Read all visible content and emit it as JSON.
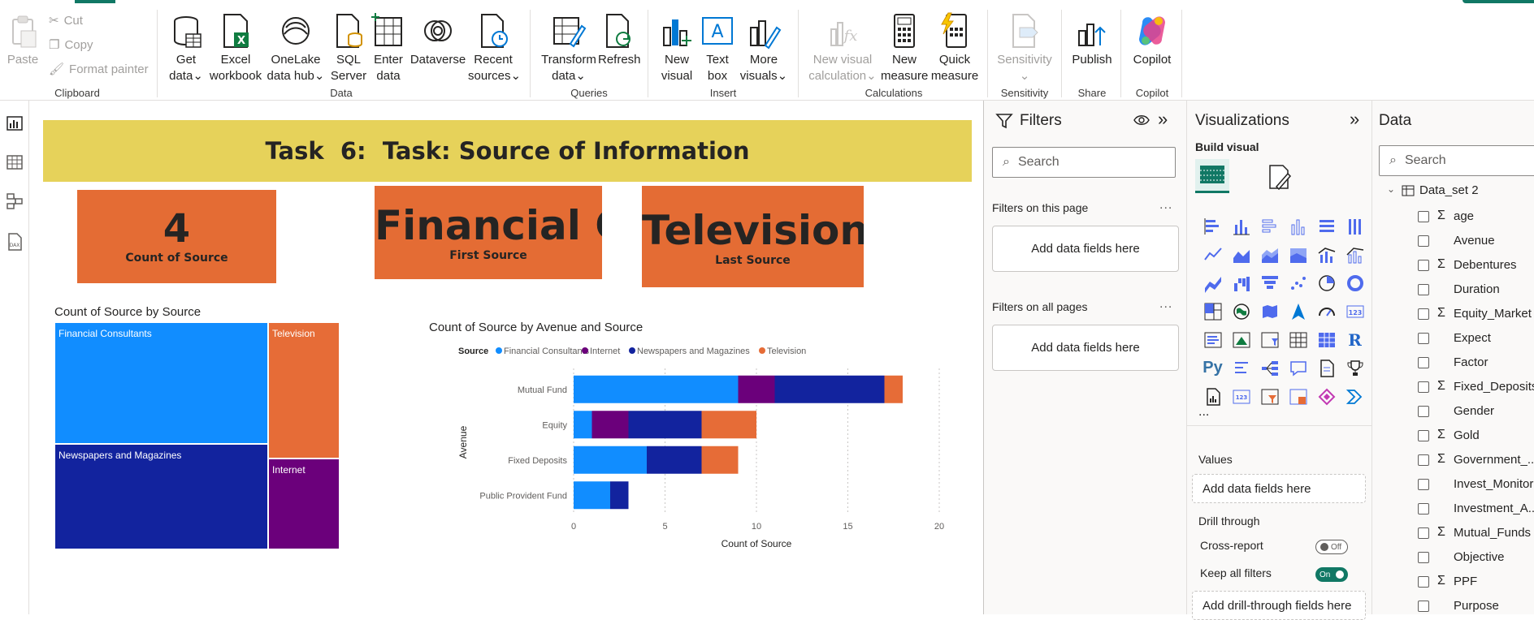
{
  "ribbon": {
    "groups": {
      "clipboard": "Clipboard",
      "data": "Data",
      "queries": "Queries",
      "insert": "Insert",
      "calculations": "Calculations",
      "sensitivity": "Sensitivity",
      "share": "Share",
      "copilot": "Copilot"
    },
    "paste": "Paste",
    "cut": "Cut",
    "copy": "Copy",
    "format_painter": "Format painter",
    "get_data": [
      "Get",
      "data"
    ],
    "excel": [
      "Excel",
      "workbook"
    ],
    "onelake": [
      "OneLake",
      "data hub"
    ],
    "sql": [
      "SQL",
      "Server"
    ],
    "enter_data": [
      "Enter",
      "data"
    ],
    "dataverse": "Dataverse",
    "recent": [
      "Recent",
      "sources"
    ],
    "transform": [
      "Transform",
      "data"
    ],
    "refresh": "Refresh",
    "new_visual": [
      "New",
      "visual"
    ],
    "text_box": [
      "Text",
      "box"
    ],
    "more_visuals": [
      "More",
      "visuals"
    ],
    "new_visual_calc": [
      "New visual",
      "calculation"
    ],
    "new_measure": [
      "New",
      "measure"
    ],
    "quick_measure": [
      "Quick",
      "measure"
    ],
    "sensitivity": "Sensitivity",
    "publish": "Publish",
    "copilot": "Copilot"
  },
  "report": {
    "title": "Task  6:  Task: Source of Information",
    "cards": [
      {
        "value": "4",
        "caption": "Count of Source"
      },
      {
        "value": "Financial C...",
        "caption": "First Source"
      },
      {
        "value": "Television",
        "caption": "Last Source"
      }
    ],
    "treemap": {
      "title": "Count of Source by Source",
      "cells": [
        {
          "label": "Financial Consultants",
          "color": "#118dff"
        },
        {
          "label": "Television",
          "color": "#e66c37"
        },
        {
          "label": "Newspapers and Magazines",
          "color": "#12239e"
        },
        {
          "label": "Internet",
          "color": "#6b007b"
        }
      ]
    }
  },
  "chart_data": {
    "type": "bar",
    "orientation": "horizontal",
    "stacked": true,
    "title": "Count of Source by Avenue and Source",
    "legend_title": "Source",
    "xlabel": "Count of Source",
    "ylabel": "Avenue",
    "xlim": [
      0,
      20
    ],
    "xticks": [
      0,
      5,
      10,
      15,
      20
    ],
    "grid": true,
    "categories": [
      "Mutual Fund",
      "Equity",
      "Fixed Deposits",
      "Public Provident Fund"
    ],
    "series": [
      {
        "name": "Financial Consultants",
        "color": "#118dff",
        "values": [
          9,
          1,
          4,
          2
        ]
      },
      {
        "name": "Internet",
        "color": "#6b007b",
        "values": [
          2,
          2,
          0,
          0
        ]
      },
      {
        "name": "Newspapers and Magazines",
        "color": "#12239e",
        "values": [
          6,
          4,
          3,
          1
        ]
      },
      {
        "name": "Television",
        "color": "#e66c37",
        "values": [
          1,
          3,
          2,
          0
        ]
      }
    ]
  },
  "filters": {
    "title": "Filters",
    "search_placeholder": "Search",
    "on_this_page": "Filters on this page",
    "on_all_pages": "Filters on all pages",
    "add_fields": "Add data fields here",
    "more": "..."
  },
  "visualizations": {
    "title": "Visualizations",
    "build_visual": "Build visual",
    "r_label": "R",
    "py_label": "Py",
    "ellipsis": "...",
    "values": "Values",
    "add_fields": "Add data fields here",
    "drill_through": "Drill through",
    "cross_report": "Cross-report",
    "cross_report_state": "Off",
    "keep_all_filters": "Keep all filters",
    "keep_all_state": "On",
    "add_drill": "Add drill-through fields here"
  },
  "datapane": {
    "title": "Data",
    "search_placeholder": "Search",
    "table": "Data_set 2",
    "fields": [
      {
        "name": "age",
        "sigma": true
      },
      {
        "name": "Avenue",
        "sigma": false
      },
      {
        "name": "Debentures",
        "sigma": true
      },
      {
        "name": "Duration",
        "sigma": false
      },
      {
        "name": "Equity_Market",
        "sigma": true
      },
      {
        "name": "Expect",
        "sigma": false
      },
      {
        "name": "Factor",
        "sigma": false
      },
      {
        "name": "Fixed_Deposits",
        "sigma": true
      },
      {
        "name": "Gender",
        "sigma": false
      },
      {
        "name": "Gold",
        "sigma": true
      },
      {
        "name": "Government_...",
        "sigma": true
      },
      {
        "name": "Invest_Monitor",
        "sigma": false
      },
      {
        "name": "Investment_A...",
        "sigma": false
      },
      {
        "name": "Mutual_Funds",
        "sigma": true
      },
      {
        "name": "Objective",
        "sigma": false
      },
      {
        "name": "PPF",
        "sigma": true
      },
      {
        "name": "Purpose",
        "sigma": false
      }
    ]
  }
}
